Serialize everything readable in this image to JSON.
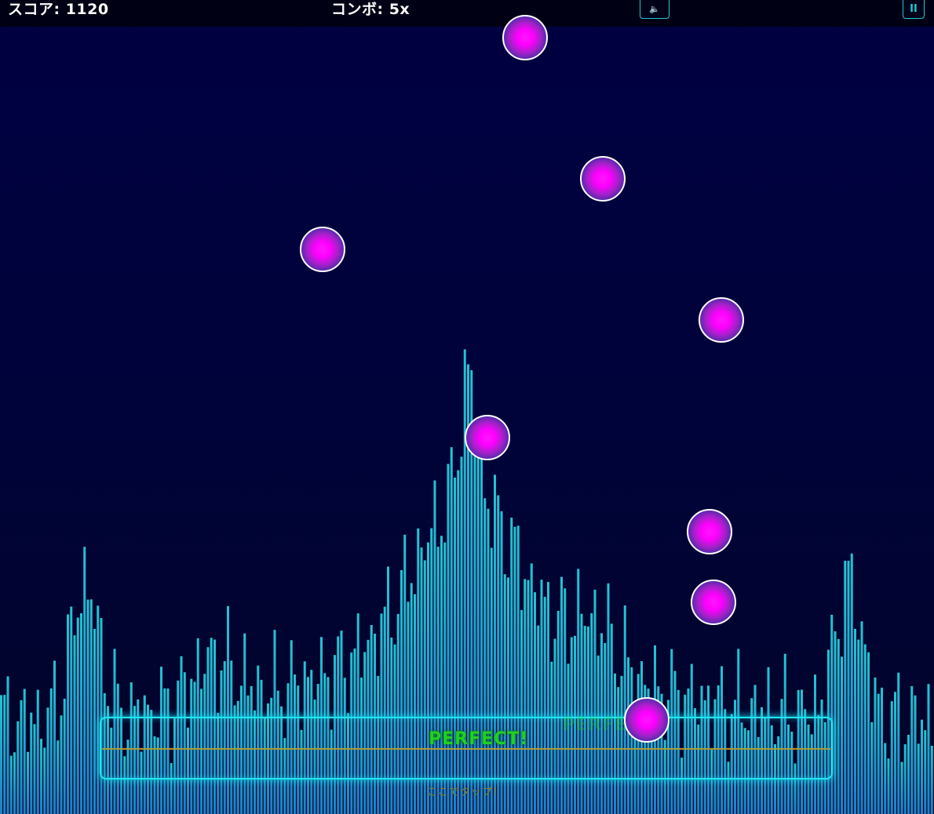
{
  "hud": {
    "score_label": "スコア: 1120",
    "combo_label": "コンボ: 5x",
    "sound_icon": "🔈",
    "pause_icon": "II"
  },
  "playfield": {
    "judgement": "PERFECT!",
    "judgement_previous": "PERFECT!",
    "tap_hint": "ここでタップ！"
  },
  "colors": {
    "bar_accent": "#22c7d8",
    "note_core": "#ff00ff",
    "judgement": "#1fd11f"
  }
}
